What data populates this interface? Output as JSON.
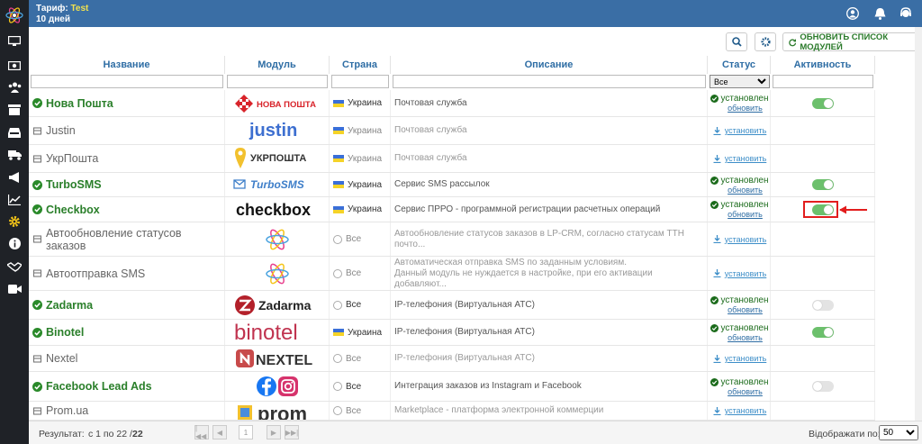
{
  "topbar": {
    "tariff_label": "Тариф:",
    "tariff_plan": "Test",
    "days": "10 дней",
    "icons": [
      "user-icon",
      "bell-icon",
      "support-icon"
    ]
  },
  "sidebar": {
    "icons": [
      "logo-icon",
      "monitor-icon",
      "money-icon",
      "users-icon",
      "archive-icon",
      "inbox-icon",
      "truck-icon",
      "megaphone-icon",
      "chart-icon",
      "gear-icon",
      "info-icon",
      "handshake-icon",
      "video-icon"
    ],
    "active": "gear-icon"
  },
  "toolbar": {
    "search": "search-icon",
    "settings": "gear-icon",
    "refresh_label": "ОБНОВИТЬ СПИСОК МОДУЛЕЙ"
  },
  "table": {
    "headers": [
      "Название",
      "Модуль",
      "Страна",
      "Описание",
      "Статус",
      "Активность"
    ],
    "status_filter": "Все",
    "rows": [
      {
        "name": "Нова Пошта",
        "logo": "НОВА ПОШТА",
        "country": "Украина",
        "description": "Почтовая служба",
        "installed": true,
        "status": "установлен",
        "status_link": "обновить",
        "active": true
      },
      {
        "name": "Justin",
        "logo": "justin",
        "country": "Украина",
        "description": "Почтовая служба",
        "installed": false,
        "status_link": "установить",
        "active": null
      },
      {
        "name": "УкрПошта",
        "logo": "УКРПОШТА",
        "country": "Украина",
        "description": "Почтовая служба",
        "installed": false,
        "status_link": "установить",
        "active": null
      },
      {
        "name": "TurboSMS",
        "logo": "TurboSMS",
        "country": "Украина",
        "description": "Сервис SMS рассылок",
        "installed": true,
        "status": "установлен",
        "status_link": "обновить",
        "active": true
      },
      {
        "name": "Checkbox",
        "logo": "checkbox",
        "country": "Украина",
        "description": "Сервис ПРРО - программной регистрации расчетных операций",
        "installed": true,
        "status": "установлен",
        "status_link": "обновить",
        "active": true,
        "highlighted": true
      },
      {
        "name": "Автообновление статусов заказов",
        "logo": "",
        "country": "Все",
        "description": "Автообновление статусов заказов в LP-CRM, согласно статусам ТТН почто...",
        "installed": false,
        "status_link": "установить",
        "active": null
      },
      {
        "name": "Автоотправка SMS",
        "logo": "",
        "country": "Все",
        "description": "Автоматическая отправка SMS по заданным условиям.\nДанный модуль не нуждается в настройке, при его активации добавляют...",
        "installed": false,
        "status_link": "установить",
        "active": null
      },
      {
        "name": "Zadarma",
        "logo": "Zadarma",
        "country": "Все",
        "description": "IP-телефония (Виртуальная АТС)",
        "installed": true,
        "status": "установлен",
        "status_link": "обновить",
        "active": false
      },
      {
        "name": "Binotel",
        "logo": "binotel",
        "country": "Украина",
        "description": "IP-телефония (Виртуальная АТС)",
        "installed": true,
        "status": "установлен",
        "status_link": "обновить",
        "active": true
      },
      {
        "name": "Nextel",
        "logo": "NEXTEL",
        "country": "Все",
        "description": "IP-телефония (Виртуальная АТС)",
        "installed": false,
        "status_link": "установить",
        "active": null
      },
      {
        "name": "Facebook Lead Ads",
        "logo": "",
        "country": "Все",
        "description": "Интеграция заказов из Instagram и Facebook",
        "installed": true,
        "status": "установлен",
        "status_link": "обновить",
        "active": false
      },
      {
        "name": "Prom.ua",
        "logo": "prom",
        "country": "Все",
        "description": "Marketplace - платформа электронной коммерции",
        "installed": false,
        "status_link": "установить",
        "active": null
      }
    ]
  },
  "footer": {
    "result_label": "Результат:",
    "range": "с 1 по 22 /",
    "total": "22",
    "page": "1",
    "per_page_label": "Відображати по:",
    "per_page": "50"
  }
}
